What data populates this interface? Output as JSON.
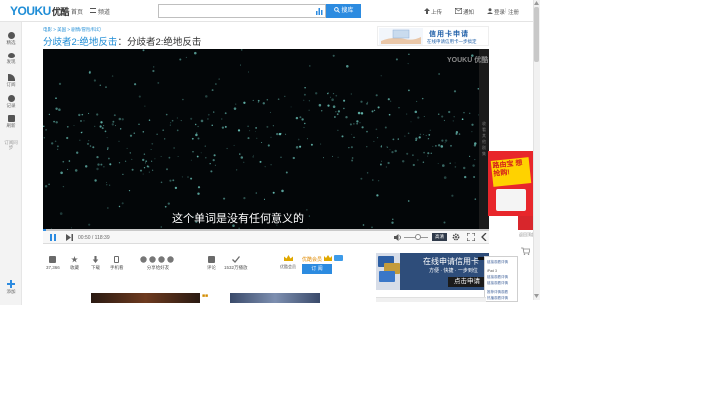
{
  "header": {
    "logo_main": "YOUKU",
    "logo_sub": "优酷",
    "nav": [
      {
        "label": "首页"
      },
      {
        "label": "频道"
      }
    ],
    "search_button": "搜库",
    "upload": "上传",
    "notify": "通知",
    "login": "登录",
    "register": "注册"
  },
  "sidebar": {
    "items": [
      {
        "label": "精选",
        "icon": "home-icon"
      },
      {
        "label": "发现",
        "icon": "eye-icon"
      },
      {
        "label": "订阅",
        "icon": "rss-icon"
      },
      {
        "label": "记录",
        "icon": "clock-icon"
      },
      {
        "label": "刷新",
        "icon": "crown-icon"
      },
      {
        "label": "订阅同步",
        "icon": "sync-icon"
      },
      {
        "label": "添加",
        "icon": "plus-icon"
      }
    ]
  },
  "breadcrumb": {
    "text": "电影 > 美国 > 剧情/冒险/科幻"
  },
  "video": {
    "title_link": "分歧者2:绝地反击",
    "title_sep": "：",
    "title_rest": "分歧者2:绝地反击",
    "subtitle": "这个单词是没有任何意义的",
    "player_logo": "YOUKU 优酷",
    "side_strip_label": "收看其他剧集"
  },
  "ad_top": {
    "title": "信用卡申请",
    "subtitle": "在线申请信用卡一步搞定"
  },
  "controls": {
    "time": "00:50 / 118:39",
    "quality": "高清"
  },
  "actions": {
    "like": {
      "label": "37,366",
      "icon": "thumbs-up-icon"
    },
    "favorite": {
      "label": "收藏",
      "icon": "star-icon"
    },
    "download": {
      "label": "下载",
      "icon": "download-icon"
    },
    "phone": {
      "label": "手机看",
      "icon": "phone-icon"
    },
    "share": {
      "label": "分享给好友",
      "icon": "share-icon"
    },
    "comment": {
      "label": "评论",
      "icon": "comment-icon"
    },
    "plays": {
      "label": "1532万播放",
      "icon": "check-icon"
    },
    "vip_badge": "优酷会员",
    "vip_text": "优酷会员",
    "vip_button": "订 阅"
  },
  "ad_bottom": {
    "title": "在线申请信用卡",
    "desc": "方便 · 快捷 · 一步到位",
    "button": "点击申请"
  },
  "popup": {
    "lines": [
      "链接观看详情",
      "iPad 3",
      "链接观看详情",
      "链接观看详情",
      "推荐详情观看",
      "热播观看详情"
    ]
  },
  "ad_side": {
    "text": "路由宝 想抢购!"
  },
  "side_tools": {
    "top": "返回顶部",
    "cart": "购物车"
  },
  "colors": {
    "brand_blue": "#1f8dd6",
    "brand_red": "#e8382f",
    "player_bg": "#030608",
    "accent_button": "#2c8be0"
  }
}
